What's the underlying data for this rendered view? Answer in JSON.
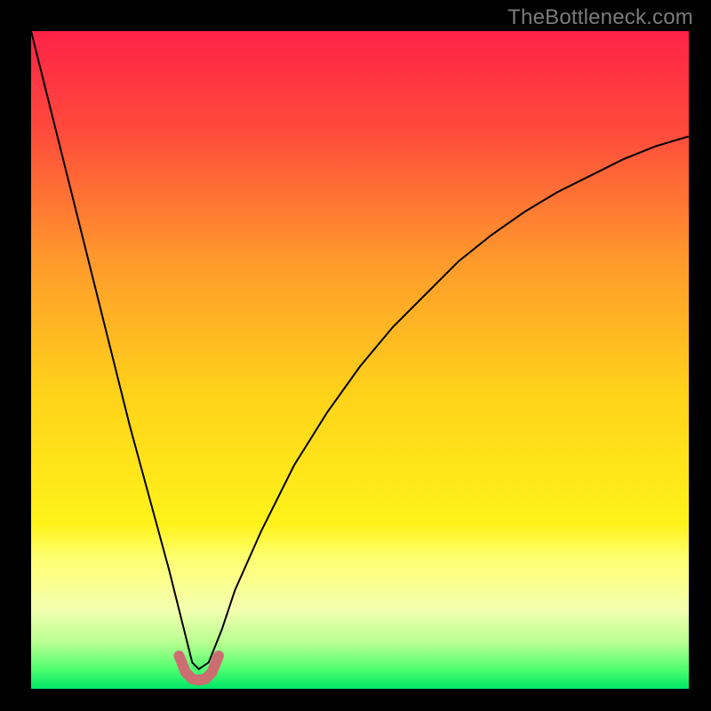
{
  "watermark": {
    "text": "TheBottleneck.com"
  },
  "chart_data": {
    "type": "line",
    "title": "",
    "xlabel": "",
    "ylabel": "",
    "xlim": [
      0,
      100
    ],
    "ylim": [
      0,
      100
    ],
    "grid": false,
    "background": {
      "description": "vertical gradient red→orange→yellow→green",
      "stops": [
        {
          "offset": 0.0,
          "color": "#ff2247"
        },
        {
          "offset": 0.15,
          "color": "#ff4a3c"
        },
        {
          "offset": 0.35,
          "color": "#ff9a2c"
        },
        {
          "offset": 0.55,
          "color": "#ffd21a"
        },
        {
          "offset": 0.75,
          "color": "#fff31a"
        },
        {
          "offset": 0.8,
          "color": "#ffff70"
        },
        {
          "offset": 0.88,
          "color": "#f4ffb0"
        },
        {
          "offset": 0.93,
          "color": "#b8ff91"
        },
        {
          "offset": 0.97,
          "color": "#4fff70"
        },
        {
          "offset": 1.0,
          "color": "#00e565"
        }
      ]
    },
    "series": [
      {
        "name": "bottleneck-curve",
        "color": "#000000",
        "stroke_width": 2,
        "x": [
          0,
          3,
          6,
          9,
          12,
          15,
          18,
          21,
          23,
          24.5,
          25.5,
          27,
          29,
          31,
          35,
          40,
          45,
          50,
          55,
          60,
          65,
          70,
          75,
          80,
          85,
          90,
          95,
          100
        ],
        "values": [
          100,
          88,
          76,
          64,
          52,
          40,
          29,
          18,
          10,
          4,
          3,
          4,
          9,
          15,
          24,
          34,
          42,
          49,
          55,
          60,
          65,
          69,
          72.5,
          75.5,
          78,
          80.5,
          82.5,
          84
        ]
      },
      {
        "name": "bottleneck-floor",
        "color": "#cc6d72",
        "stroke_width": 12,
        "linecap": "round",
        "x": [
          22.5,
          23.5,
          24.5,
          25.5,
          26.5,
          27.5,
          28.5
        ],
        "values": [
          5,
          2.5,
          1.5,
          1.3,
          1.5,
          2.5,
          5
        ]
      }
    ],
    "annotations": []
  }
}
